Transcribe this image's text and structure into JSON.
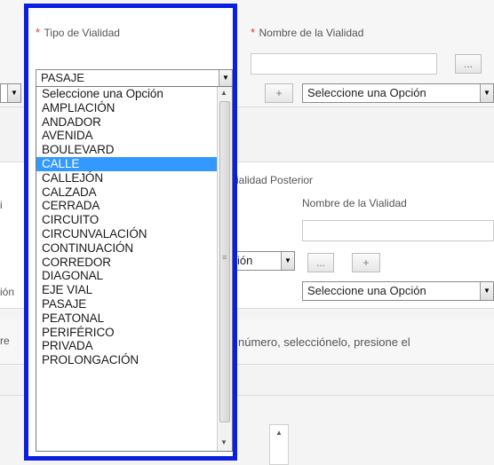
{
  "form": {
    "required_mark": "*",
    "tipo_label": "Tipo de Vialidad",
    "nombre_label": "Nombre de la Vialidad",
    "add_button": "+",
    "more_button": "...",
    "select_placeholder": "Seleccione una Opción",
    "vialidad_posterior_label": "ialidad Posterior",
    "nombre_label_2": "Nombre de la Vialidad",
    "cut_option_text": "ión",
    "cut_text_left_1": "i",
    "cut_text_left_2": "ión",
    "cut_text_left_3": "re",
    "instruction_text": "número, selecciónelo, presione el"
  },
  "dropdown": {
    "selected_value": "PASAJE",
    "highlighted": "CALLE",
    "options": [
      "Seleccione una Opción",
      "AMPLIACIÓN",
      "ANDADOR",
      "AVENIDA",
      "BOULEVARD",
      "CALLE",
      "CALLEJÓN",
      "CALZADA",
      "CERRADA",
      "CIRCUITO",
      "CIRCUNVALACIÓN",
      "CONTINUACIÓN",
      "CORREDOR",
      "DIAGONAL",
      "EJE VIAL",
      "PASAJE",
      "PEATONAL",
      "PERIFÉRICO",
      "PRIVADA",
      "PROLONGACIÓN"
    ]
  },
  "colors": {
    "highlight_frame": "#0a1fe0",
    "selected_option_bg": "#3399ff",
    "required_mark": "#e33333"
  }
}
